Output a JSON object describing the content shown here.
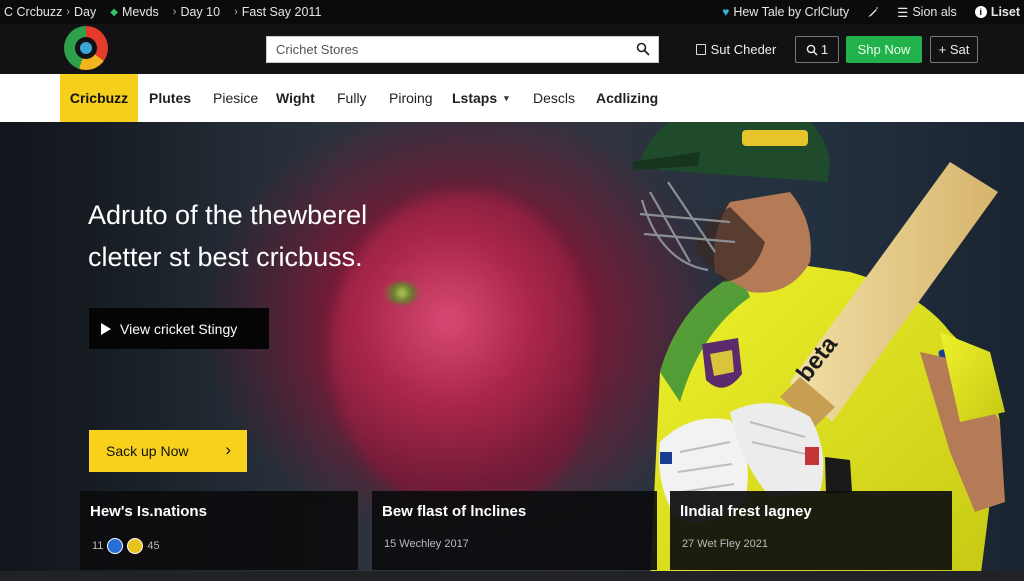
{
  "ticker": {
    "items": [
      "C Crcbuzz",
      "Day",
      "Mevds",
      "Day 10",
      "Fast Say 2011"
    ],
    "right": {
      "tale": "Hew Tale by CrlCluty",
      "scores": "Sion als",
      "list": "Liset"
    }
  },
  "header": {
    "search_placeholder": "Crichet Stores",
    "scheduler": "Sut Cheder",
    "q_label": "1",
    "shop": "Shp Now",
    "set": "+ Sat"
  },
  "nav": {
    "brand": "Cricbuzz",
    "items": [
      "Plutes",
      "Piesice",
      "Wight",
      "Fully",
      "Piroing",
      "Lstaps",
      "Descls",
      "Acdlizing"
    ]
  },
  "hero": {
    "headline_line1": "Adruto of the thewberel",
    "headline_line2": "cletter st best cricbuss.",
    "view_button": "View cricket Stingy",
    "cta_button": "Sack up Now"
  },
  "cards": [
    {
      "title": "Hew's Is.nations",
      "meta_count": "11",
      "meta_count2": "45"
    },
    {
      "title": "Bew flast of lnclines",
      "meta": "15 Wechley 2017"
    },
    {
      "title": "lIndial frest lagney",
      "meta": "27 Wet Fley 2021"
    }
  ],
  "colors": {
    "accent_yellow": "#f7d11c",
    "shop_green": "#22b24c",
    "jersey": "#e6e619",
    "helmet": "#1f4a2c"
  }
}
